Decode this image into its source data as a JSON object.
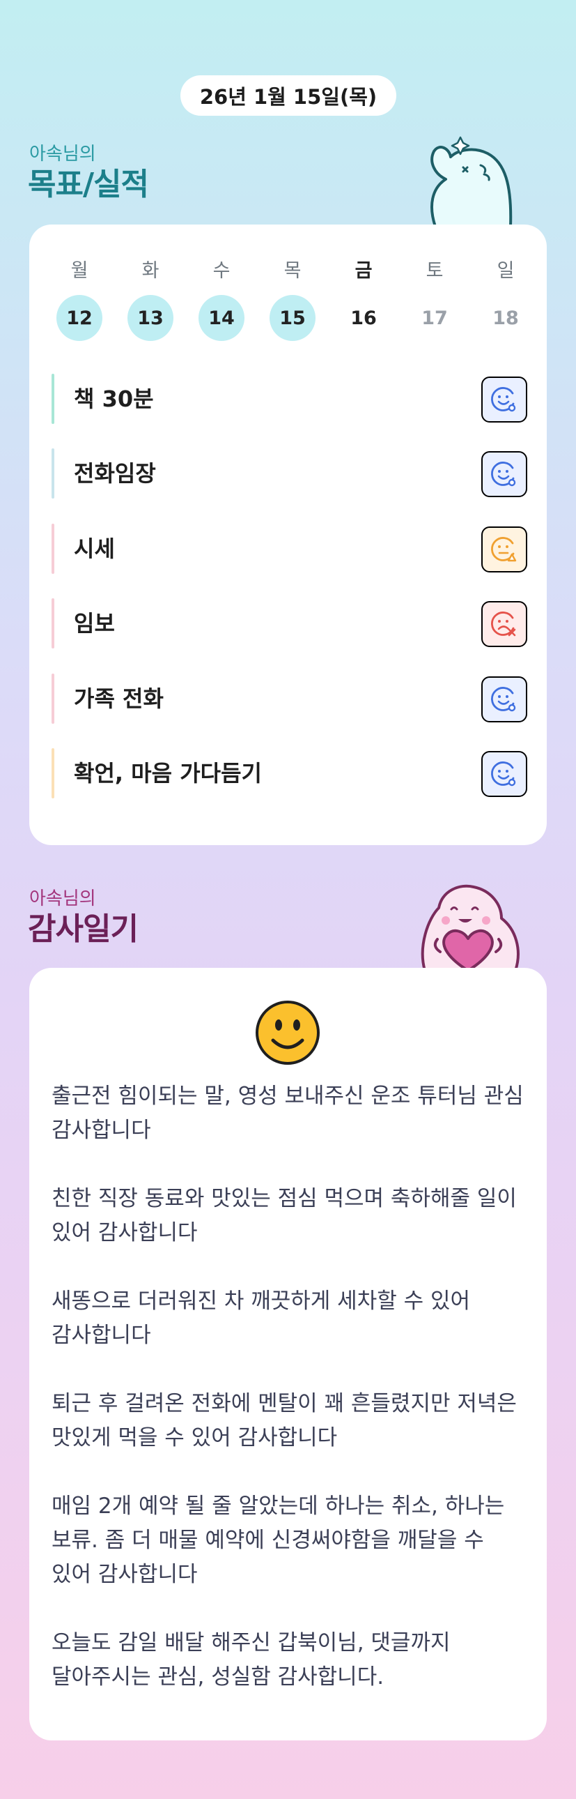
{
  "date": "26년 1월 15일(목)",
  "goals_section": {
    "subtitle": "아속님의",
    "title": "목표/실적"
  },
  "week": [
    {
      "name": "월",
      "num": "12",
      "state": "done"
    },
    {
      "name": "화",
      "num": "13",
      "state": "done"
    },
    {
      "name": "수",
      "num": "14",
      "state": "done"
    },
    {
      "name": "목",
      "num": "15",
      "state": "done"
    },
    {
      "name": "금",
      "num": "16",
      "state": "today"
    },
    {
      "name": "토",
      "num": "17",
      "state": "future"
    },
    {
      "name": "일",
      "num": "18",
      "state": "future"
    }
  ],
  "goals": [
    {
      "label": "책 30분",
      "status": "good",
      "bar_color": "#a8e6d6",
      "icon": "smile-circle-icon"
    },
    {
      "label": "전화임장",
      "status": "good",
      "bar_color": "#c9e4ec",
      "icon": "smile-circle-icon"
    },
    {
      "label": "시세",
      "status": "mid",
      "bar_color": "#f6cdd6",
      "icon": "neutral-triangle-icon"
    },
    {
      "label": "임보",
      "status": "bad",
      "bar_color": "#f6cdd6",
      "icon": "sad-x-icon"
    },
    {
      "label": "가족 전화",
      "status": "good",
      "bar_color": "#f6cdd6",
      "icon": "smile-circle-icon"
    },
    {
      "label": "확언, 마음 가다듬기",
      "status": "good",
      "bar_color": "#fbe0b6",
      "icon": "smile-circle-icon"
    }
  ],
  "gratitude_section": {
    "subtitle": "아속님의",
    "title": "감사일기"
  },
  "gratitude": {
    "mood_icon": "smiley-face-icon",
    "entries": [
      "출근전 힘이되는 말, 영성 보내주신 운조 튜터님 관심 감사합니다",
      "친한 직장 동료와 맛있는 점심 먹으며 축하해줄 일이 있어 감사합니다",
      "새똥으로 더러워진 차 깨끗하게 세차할 수 있어 감사합니다",
      "퇴근 후 걸려온 전화에 멘탈이 꽤 흔들렸지만 저녁은 맛있게 먹을 수 있어 감사합니다",
      "매임 2개 예약 될 줄 알았는데 하나는 취소, 하나는 보류. 좀 더 매물 예약에 신경써야함을 깨달을 수 있어 감사합니다",
      "오늘도 감일 배달 해주신 갑북이님, 댓글까지 달아주시는 관심, 성실함 감사합니다."
    ]
  },
  "colors": {
    "done_day": "#bfeef3",
    "good": "#3f6fe0",
    "mid": "#f0a030",
    "bad": "#e5534b",
    "title_goals": "#1c7f8a",
    "title_gratitude": "#6b2057"
  }
}
